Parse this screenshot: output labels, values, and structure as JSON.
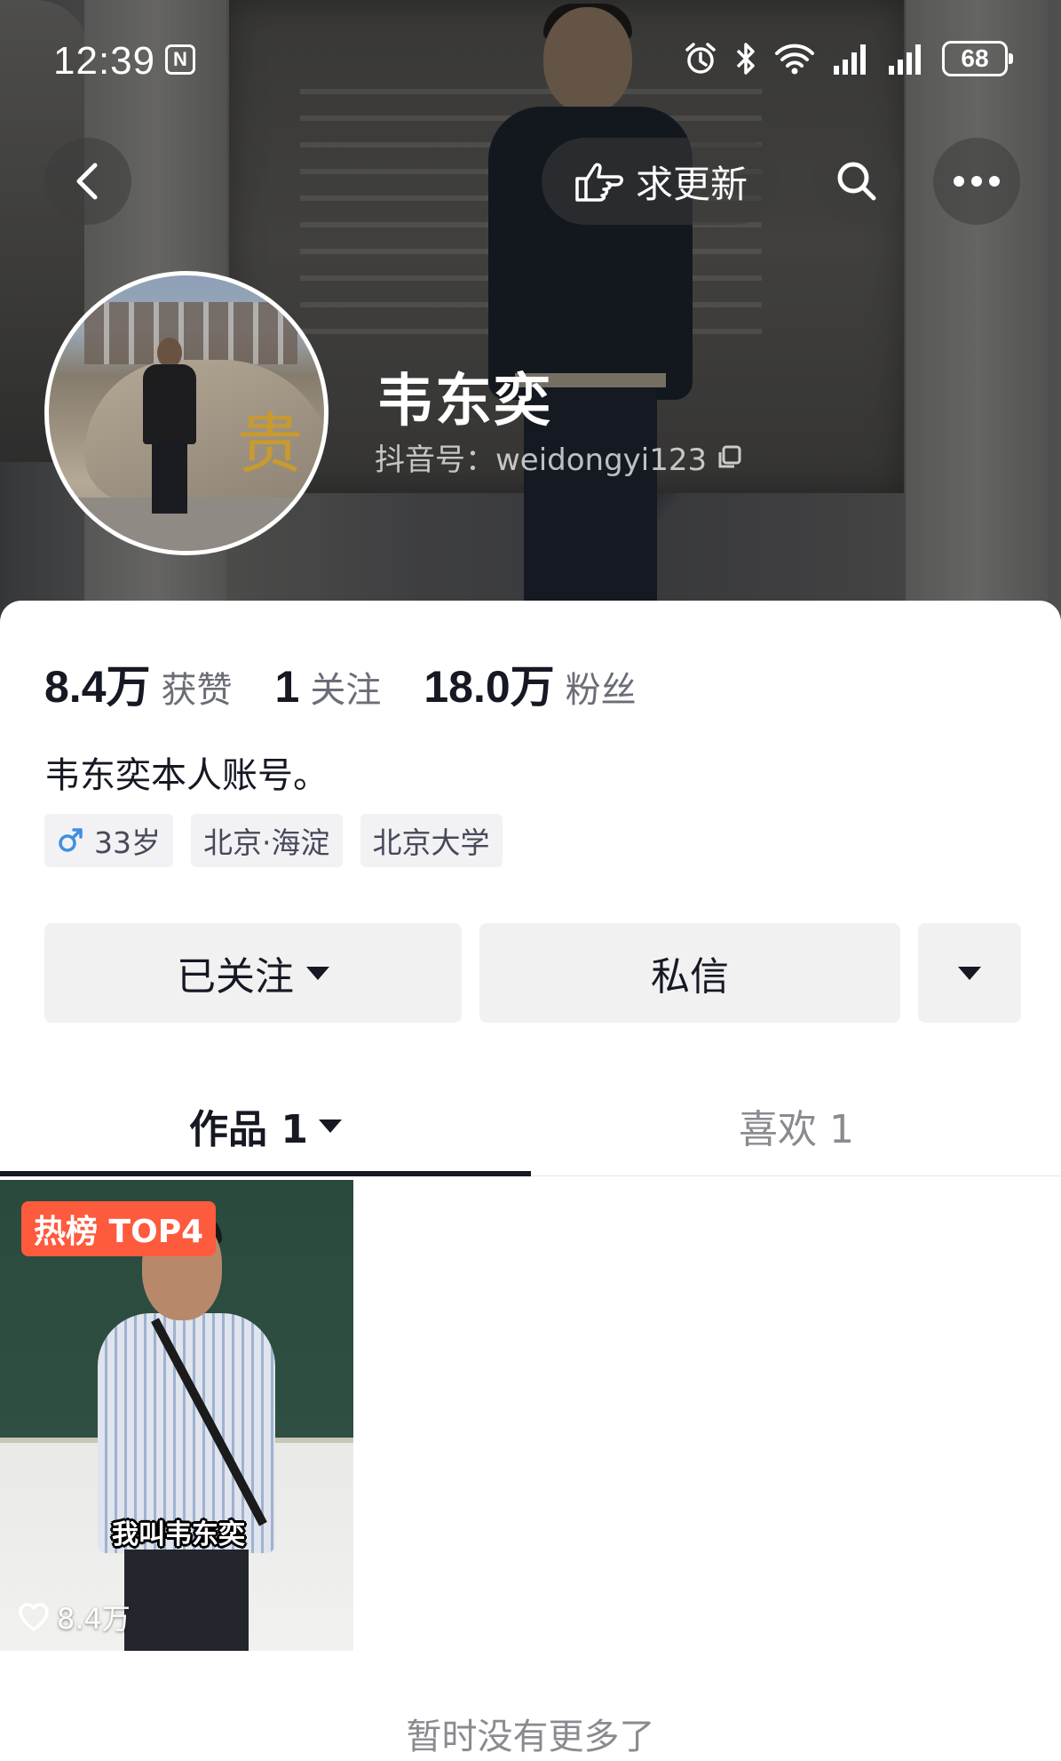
{
  "status_bar": {
    "time": "12:39",
    "nfc": "N",
    "battery": "68",
    "icons": [
      "alarm-icon",
      "bluetooth-icon",
      "wifi-icon",
      "signal-icon",
      "signal-icon",
      "battery-icon"
    ]
  },
  "nav": {
    "request_update_label": "求更新"
  },
  "profile": {
    "name": "韦东奕",
    "douyin_id": "抖音号：weidongyi123",
    "bio": "韦东奕本人账号。"
  },
  "stats": [
    {
      "value": "8.4万",
      "label": "获赞"
    },
    {
      "value": "1",
      "label": "关注"
    },
    {
      "value": "18.0万",
      "label": "粉丝"
    }
  ],
  "tags": {
    "age": "33岁",
    "location": "北京·海淀",
    "school": "北京大学"
  },
  "actions": {
    "followed_label": "已关注",
    "message_label": "私信"
  },
  "tabs": {
    "works_label": "作品 1",
    "likes_label": "喜欢 1"
  },
  "video": {
    "badge": "热榜 TOP4",
    "caption": "我叫韦东奕",
    "likes": "8.4万"
  },
  "footer": {
    "no_more": "暂时没有更多了"
  },
  "colors": {
    "accent_badge": "#fe5a3d",
    "male_icon": "#3f8ee3",
    "text_primary": "#161823",
    "text_secondary": "#8a8b91"
  }
}
